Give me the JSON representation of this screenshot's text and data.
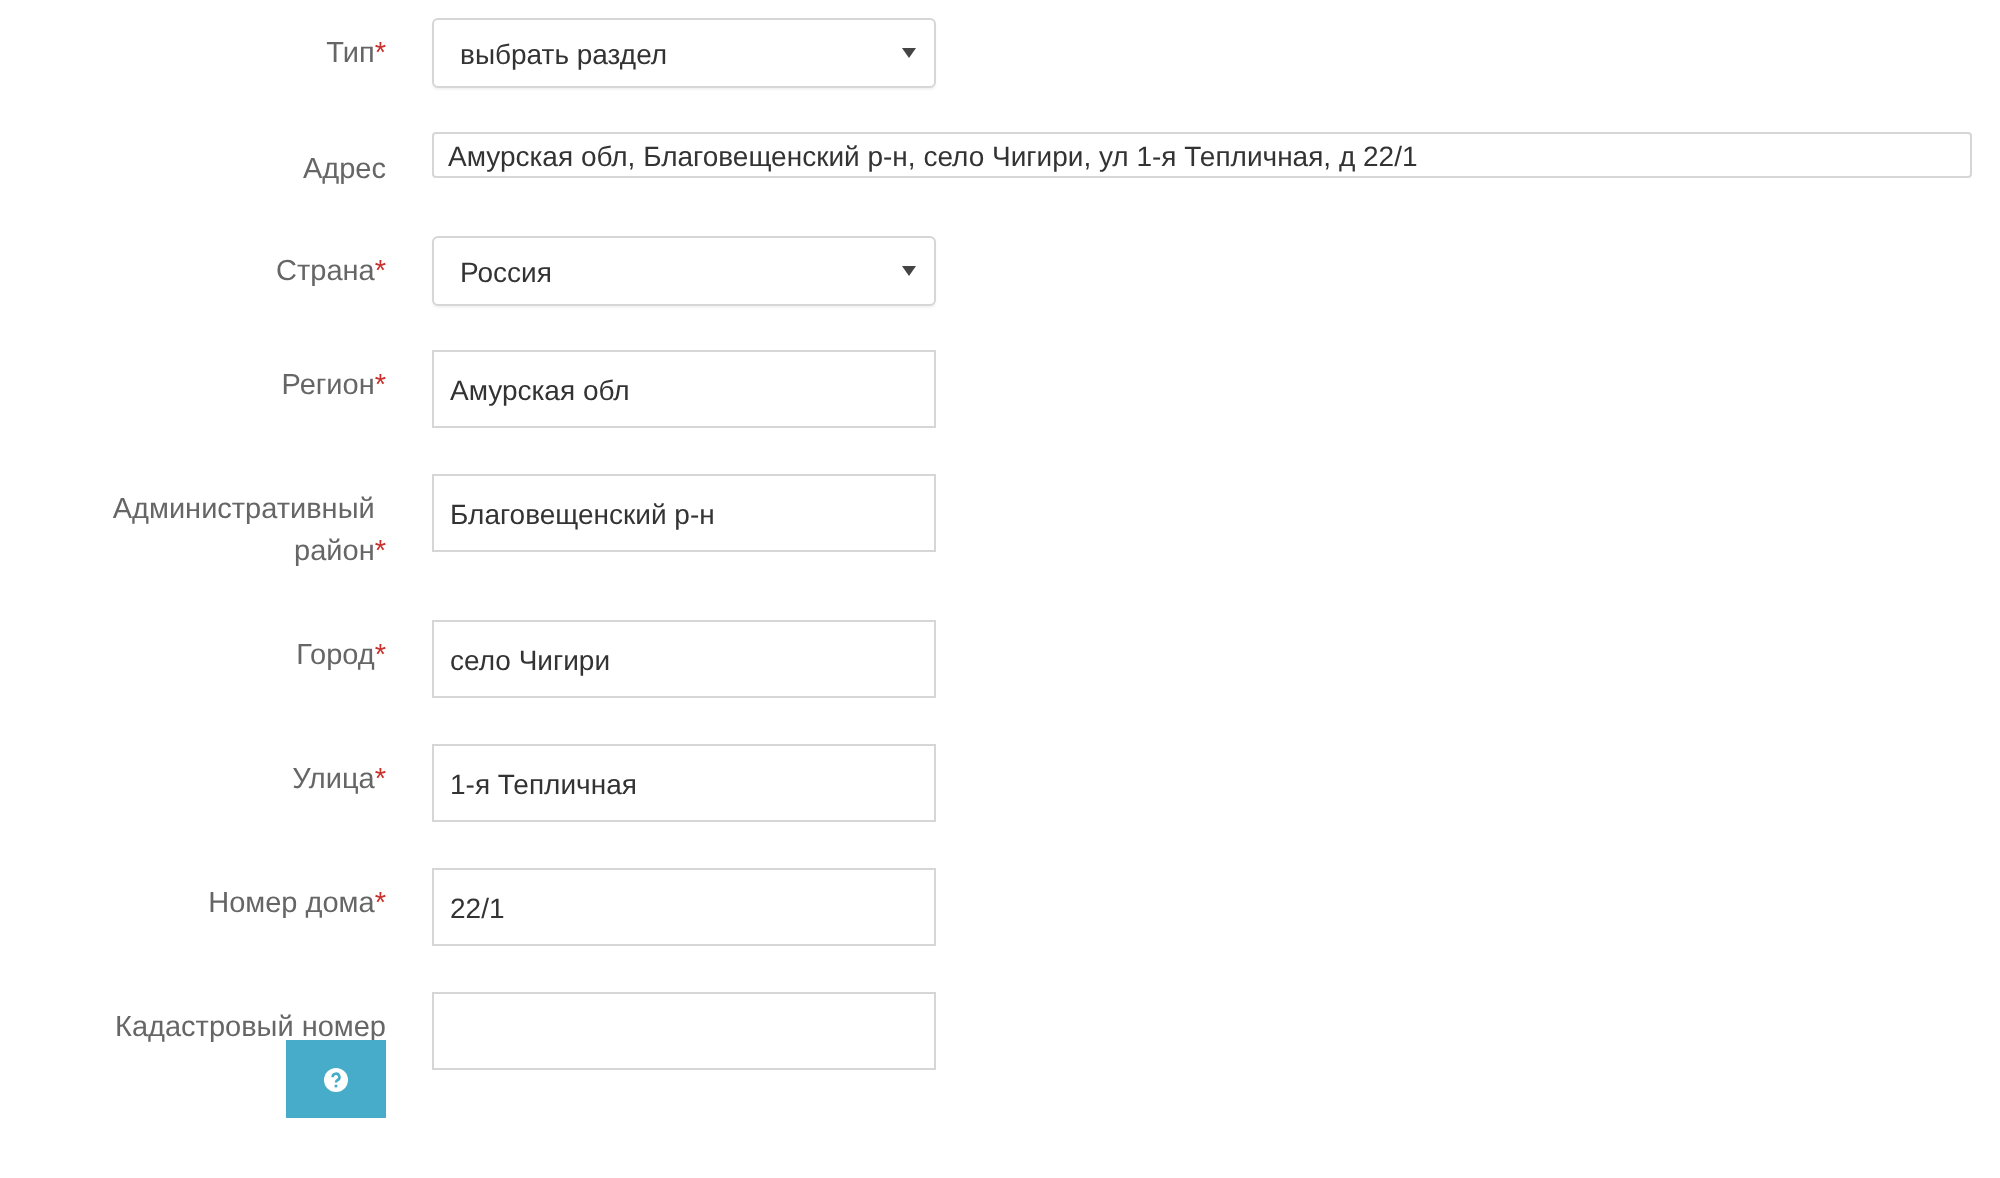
{
  "fields": [
    {
      "label": "Тип",
      "required_mark": "*",
      "kind": "select",
      "value": "выбрать раздел"
    },
    {
      "label": "Адрес",
      "kind": "wide",
      "value": "Амурская обл, Благовещенский р-н, село Чигири, ул 1-я Тепличная, д 22/1"
    },
    {
      "label": "Страна",
      "required_mark": "*",
      "kind": "select",
      "value": "Россия"
    },
    {
      "label": "Регион",
      "required_mark": "*",
      "kind": "text",
      "value": "Амурская обл"
    },
    {
      "label": "Административный район",
      "required_mark": "*",
      "kind": "text",
      "value": "Благовещенский р-н"
    },
    {
      "label": "Город",
      "required_mark": "*",
      "kind": "text",
      "value": "село Чигири"
    },
    {
      "label": "Улица",
      "required_mark": "*",
      "kind": "text",
      "value": "1-я Тепличная"
    },
    {
      "label": "Номер дома",
      "required_mark": "*",
      "kind": "text",
      "value": "22/1"
    },
    {
      "label": "Кадастровый номер",
      "kind": "text",
      "help": true
    }
  ]
}
